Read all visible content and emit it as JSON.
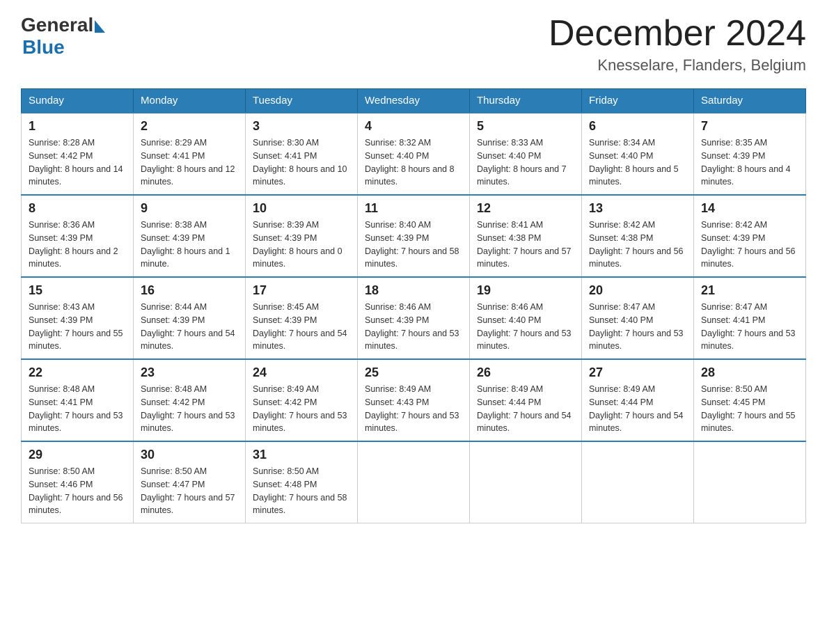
{
  "header": {
    "logo_line1": "General",
    "logo_line2": "Blue",
    "month_title": "December 2024",
    "location": "Knesselare, Flanders, Belgium"
  },
  "columns": [
    "Sunday",
    "Monday",
    "Tuesday",
    "Wednesday",
    "Thursday",
    "Friday",
    "Saturday"
  ],
  "weeks": [
    [
      {
        "day": "1",
        "sunrise": "8:28 AM",
        "sunset": "4:42 PM",
        "daylight": "8 hours and 14 minutes."
      },
      {
        "day": "2",
        "sunrise": "8:29 AM",
        "sunset": "4:41 PM",
        "daylight": "8 hours and 12 minutes."
      },
      {
        "day": "3",
        "sunrise": "8:30 AM",
        "sunset": "4:41 PM",
        "daylight": "8 hours and 10 minutes."
      },
      {
        "day": "4",
        "sunrise": "8:32 AM",
        "sunset": "4:40 PM",
        "daylight": "8 hours and 8 minutes."
      },
      {
        "day": "5",
        "sunrise": "8:33 AM",
        "sunset": "4:40 PM",
        "daylight": "8 hours and 7 minutes."
      },
      {
        "day": "6",
        "sunrise": "8:34 AM",
        "sunset": "4:40 PM",
        "daylight": "8 hours and 5 minutes."
      },
      {
        "day": "7",
        "sunrise": "8:35 AM",
        "sunset": "4:39 PM",
        "daylight": "8 hours and 4 minutes."
      }
    ],
    [
      {
        "day": "8",
        "sunrise": "8:36 AM",
        "sunset": "4:39 PM",
        "daylight": "8 hours and 2 minutes."
      },
      {
        "day": "9",
        "sunrise": "8:38 AM",
        "sunset": "4:39 PM",
        "daylight": "8 hours and 1 minute."
      },
      {
        "day": "10",
        "sunrise": "8:39 AM",
        "sunset": "4:39 PM",
        "daylight": "8 hours and 0 minutes."
      },
      {
        "day": "11",
        "sunrise": "8:40 AM",
        "sunset": "4:39 PM",
        "daylight": "7 hours and 58 minutes."
      },
      {
        "day": "12",
        "sunrise": "8:41 AM",
        "sunset": "4:38 PM",
        "daylight": "7 hours and 57 minutes."
      },
      {
        "day": "13",
        "sunrise": "8:42 AM",
        "sunset": "4:38 PM",
        "daylight": "7 hours and 56 minutes."
      },
      {
        "day": "14",
        "sunrise": "8:42 AM",
        "sunset": "4:39 PM",
        "daylight": "7 hours and 56 minutes."
      }
    ],
    [
      {
        "day": "15",
        "sunrise": "8:43 AM",
        "sunset": "4:39 PM",
        "daylight": "7 hours and 55 minutes."
      },
      {
        "day": "16",
        "sunrise": "8:44 AM",
        "sunset": "4:39 PM",
        "daylight": "7 hours and 54 minutes."
      },
      {
        "day": "17",
        "sunrise": "8:45 AM",
        "sunset": "4:39 PM",
        "daylight": "7 hours and 54 minutes."
      },
      {
        "day": "18",
        "sunrise": "8:46 AM",
        "sunset": "4:39 PM",
        "daylight": "7 hours and 53 minutes."
      },
      {
        "day": "19",
        "sunrise": "8:46 AM",
        "sunset": "4:40 PM",
        "daylight": "7 hours and 53 minutes."
      },
      {
        "day": "20",
        "sunrise": "8:47 AM",
        "sunset": "4:40 PM",
        "daylight": "7 hours and 53 minutes."
      },
      {
        "day": "21",
        "sunrise": "8:47 AM",
        "sunset": "4:41 PM",
        "daylight": "7 hours and 53 minutes."
      }
    ],
    [
      {
        "day": "22",
        "sunrise": "8:48 AM",
        "sunset": "4:41 PM",
        "daylight": "7 hours and 53 minutes."
      },
      {
        "day": "23",
        "sunrise": "8:48 AM",
        "sunset": "4:42 PM",
        "daylight": "7 hours and 53 minutes."
      },
      {
        "day": "24",
        "sunrise": "8:49 AM",
        "sunset": "4:42 PM",
        "daylight": "7 hours and 53 minutes."
      },
      {
        "day": "25",
        "sunrise": "8:49 AM",
        "sunset": "4:43 PM",
        "daylight": "7 hours and 53 minutes."
      },
      {
        "day": "26",
        "sunrise": "8:49 AM",
        "sunset": "4:44 PM",
        "daylight": "7 hours and 54 minutes."
      },
      {
        "day": "27",
        "sunrise": "8:49 AM",
        "sunset": "4:44 PM",
        "daylight": "7 hours and 54 minutes."
      },
      {
        "day": "28",
        "sunrise": "8:50 AM",
        "sunset": "4:45 PM",
        "daylight": "7 hours and 55 minutes."
      }
    ],
    [
      {
        "day": "29",
        "sunrise": "8:50 AM",
        "sunset": "4:46 PM",
        "daylight": "7 hours and 56 minutes."
      },
      {
        "day": "30",
        "sunrise": "8:50 AM",
        "sunset": "4:47 PM",
        "daylight": "7 hours and 57 minutes."
      },
      {
        "day": "31",
        "sunrise": "8:50 AM",
        "sunset": "4:48 PM",
        "daylight": "7 hours and 58 minutes."
      },
      null,
      null,
      null,
      null
    ]
  ],
  "labels": {
    "sunrise_prefix": "Sunrise: ",
    "sunset_prefix": "Sunset: ",
    "daylight_prefix": "Daylight: "
  }
}
